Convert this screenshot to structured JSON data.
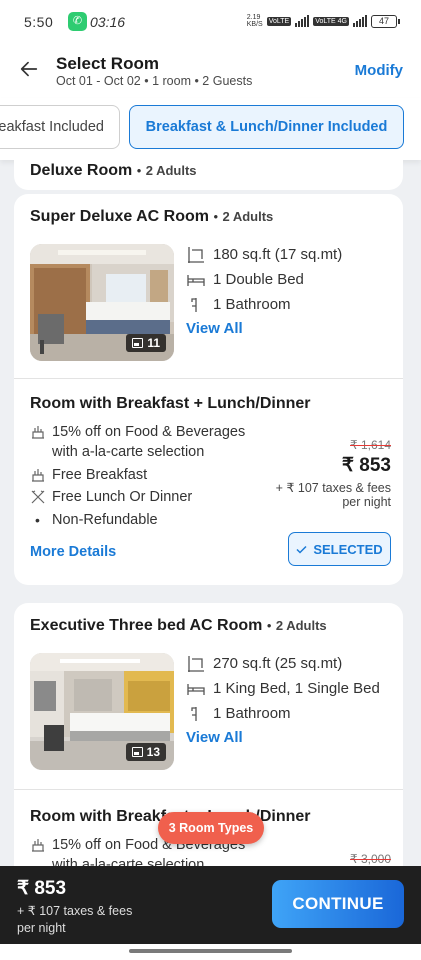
{
  "status_bar": {
    "time": "5:50",
    "call_time": "03:16",
    "network_speed_value": "2.19",
    "network_speed_unit": "KB/S",
    "network_tag_1": "VoLTE",
    "network_tag_2": "VoLTE 4G",
    "battery": "47"
  },
  "header": {
    "title": "Select Room",
    "subtitle": "Oct 01 - Oct 02 • 1 room • 2 Guests",
    "modify_label": "Modify"
  },
  "filters": [
    {
      "label": "eakfast Included",
      "selected": false
    },
    {
      "label": "Breakfast & Lunch/Dinner Included",
      "selected": true
    }
  ],
  "previous_room": {
    "name": "Deluxe Room",
    "separator": "•",
    "occupancy": "2 Adults"
  },
  "rooms": [
    {
      "name": "Super Deluxe AC Room",
      "separator": "•",
      "occupancy": "2 Adults",
      "photo_count": "11",
      "amenities": [
        {
          "icon": "area-icon",
          "text": "180 sq.ft (17 sq.mt)"
        },
        {
          "icon": "bed-icon",
          "text": "1 Double Bed"
        },
        {
          "icon": "bathroom-icon",
          "text": "1 Bathroom"
        }
      ],
      "view_all_label": "View All",
      "plan": {
        "name": "Room with Breakfast + Lunch/Dinner",
        "perks": [
          {
            "icon": "food-discount-icon",
            "line1": "15% off on Food & Beverages",
            "line2": "with a-la-carte selection"
          },
          {
            "icon": "breakfast-icon",
            "line1": "Free Breakfast"
          },
          {
            "icon": "cutlery-icon",
            "line1": "Free Lunch Or Dinner"
          },
          {
            "icon": "bullet",
            "line1": "Non-Refundable"
          }
        ],
        "original_price": "₹ 1,614",
        "price": "₹ 853",
        "taxes": "+ ₹ 107 taxes & fees",
        "per_night": "per night",
        "more_details_label": "More Details",
        "selected_label": "SELECTED"
      }
    },
    {
      "name": "Executive Three bed AC Room",
      "separator": "•",
      "occupancy": "2 Adults",
      "photo_count": "13",
      "amenities": [
        {
          "icon": "area-icon",
          "text": "270 sq.ft (25 sq.mt)"
        },
        {
          "icon": "bed-icon",
          "text": "1 King Bed, 1 Single Bed"
        },
        {
          "icon": "bathroom-icon",
          "text": "1 Bathroom"
        }
      ],
      "view_all_label": "View All",
      "plan": {
        "name": "Room with Breakfast + Lunch/Dinner",
        "perks": [
          {
            "icon": "food-discount-icon",
            "line1": "15% off on Food & Beverages",
            "line2": "with a-la-carte selection"
          }
        ],
        "original_price": "₹ 3,000"
      }
    }
  ],
  "room_types_badge": "3 Room Types",
  "footer": {
    "price": "₹ 853",
    "taxes": "+ ₹ 107 taxes & fees",
    "per_night": "per night",
    "continue_label": "CONTINUE"
  },
  "colors": {
    "accent": "#1a7ad6",
    "badge": "#f0604d",
    "bottom_bar": "#1f1f1f"
  }
}
